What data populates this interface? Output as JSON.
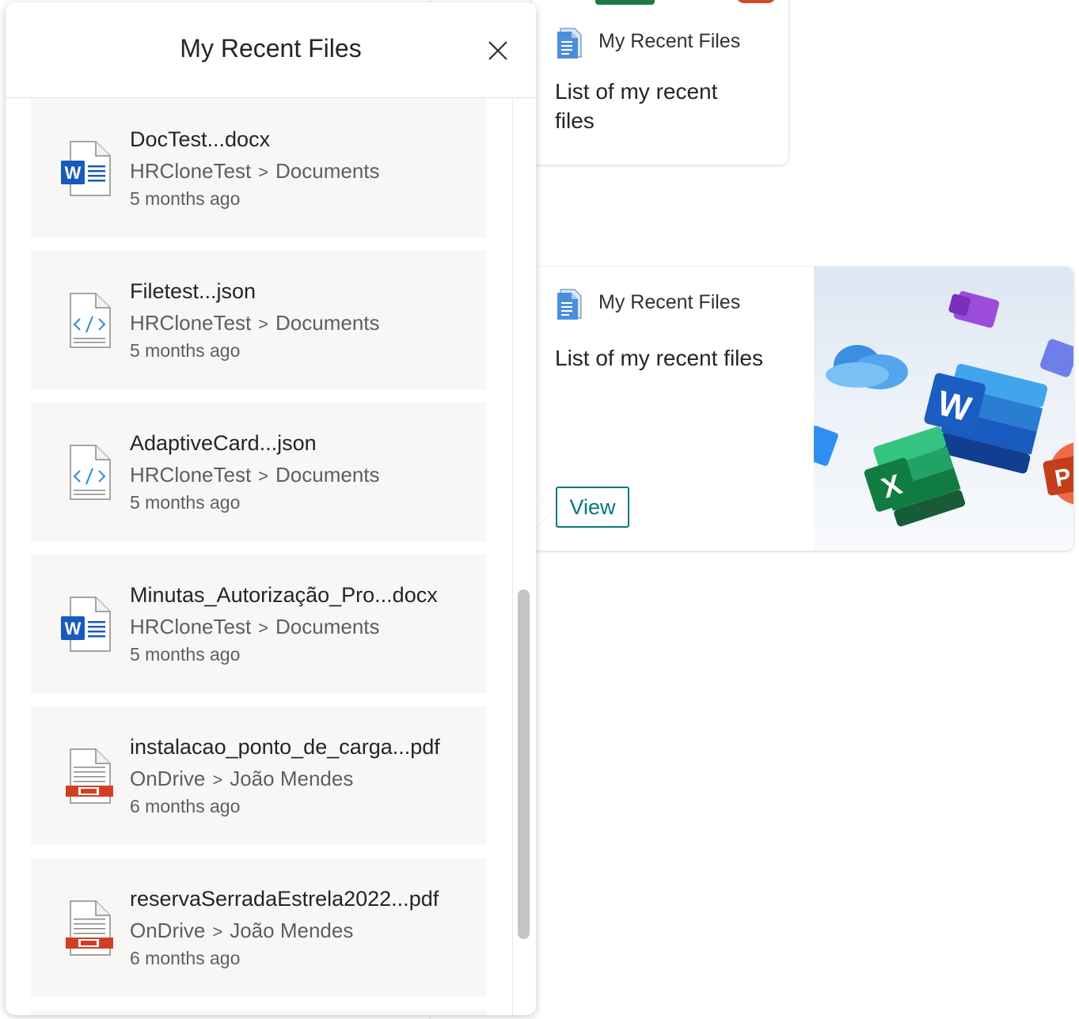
{
  "panel": {
    "title": "My Recent Files",
    "files": [
      {
        "name": "DocTest...docx",
        "location": "HRCloneTest",
        "folder": "Documents",
        "time": "5 months ago",
        "icon": "word-file-icon"
      },
      {
        "name": "Filetest...json",
        "location": "HRCloneTest",
        "folder": "Documents",
        "time": "5 months ago",
        "icon": "code-file-icon"
      },
      {
        "name": "AdaptiveCard...json",
        "location": "HRCloneTest",
        "folder": "Documents",
        "time": "5 months ago",
        "icon": "code-file-icon"
      },
      {
        "name": "Minutas_Autorização_Pro...docx",
        "location": "HRCloneTest",
        "folder": "Documents",
        "time": "5 months ago",
        "icon": "word-file-icon"
      },
      {
        "name": "instalacao_ponto_de_carga...pdf",
        "location": "OnDrive",
        "folder": "João Mendes",
        "time": "6 months ago",
        "icon": "pdf-file-icon"
      },
      {
        "name": "reservaSerradaEstrela2022...pdf",
        "location": "OnDrive",
        "folder": "João Mendes",
        "time": "6 months ago",
        "icon": "pdf-file-icon"
      }
    ],
    "separator": ">"
  },
  "card_small": {
    "title": "My Recent Files",
    "description": "List of my recent files"
  },
  "card_large": {
    "title": "My Recent Files",
    "description": "List of my recent files",
    "button_label": "View"
  },
  "colors": {
    "accent": "#03787c",
    "word_blue": "#185abd",
    "pdf_red": "#d13f22",
    "item_bg": "#f8f7f6"
  }
}
